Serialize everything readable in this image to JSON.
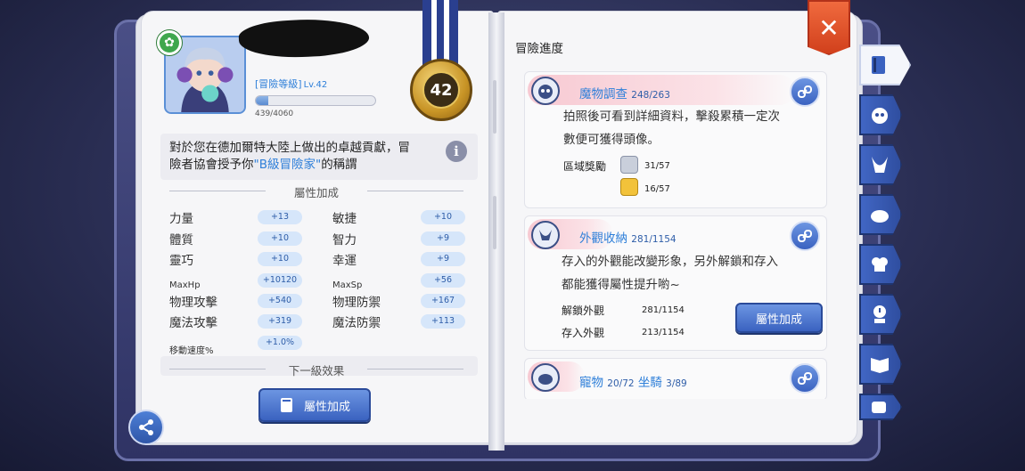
{
  "player": {
    "adventure_level_label": "[冒險等級]",
    "level": "Lv.42",
    "exp_text": "439/4060",
    "exp_fraction": 0.108,
    "medal_level": "42"
  },
  "description": {
    "line1": "對於您在德加爾特大陸上做出的卓越貢獻，冒",
    "line2_prefix": "險者協會授予你",
    "title_name": "\"B級冒險家\"",
    "line2_suffix": "的稱謂"
  },
  "stats_section": {
    "heading": "屬性加成",
    "left": [
      {
        "label": "力量",
        "value": "+13"
      },
      {
        "label": "體質",
        "value": "+10"
      },
      {
        "label": "靈巧",
        "value": "+10"
      },
      {
        "label": "MaxHp",
        "value": "+10120"
      },
      {
        "label": "物理攻擊",
        "value": "+540"
      },
      {
        "label": "魔法攻擊",
        "value": "+319"
      },
      {
        "label": "移動速度%",
        "value": "+1.0%"
      }
    ],
    "right": [
      {
        "label": "敏捷",
        "value": "+10"
      },
      {
        "label": "智力",
        "value": "+9"
      },
      {
        "label": "幸運",
        "value": "+9"
      },
      {
        "label": "MaxSp",
        "value": "+56"
      },
      {
        "label": "物理防禦",
        "value": "+167"
      },
      {
        "label": "魔法防禦",
        "value": "+113"
      }
    ],
    "next_level_heading": "下一級效果",
    "button_label": "屬性加成"
  },
  "progress": {
    "title": "冒險進度",
    "monster": {
      "title": "魔物調查",
      "count": "248/263",
      "text1": "拍照後可看到詳細資料，擊殺累積一定次",
      "text2": "數便可獲得頭像。",
      "reward_label": "區域獎勵",
      "reward1": "31/57",
      "reward2": "16/57"
    },
    "appearance": {
      "title": "外觀收納",
      "count": "281/1154",
      "text1": "存入的外觀能改變形象，另外解鎖和存入",
      "text2": "都能獲得屬性提升喲~",
      "unlocked_label": "解鎖外觀",
      "unlocked_value": "281/1154",
      "stored_label": "存入外觀",
      "stored_value": "213/1154",
      "button_label": "屬性加成"
    },
    "pet": {
      "title": "寵物",
      "pet_count": "20/72",
      "mount_title": "坐騎",
      "mount_count": "3/89"
    }
  },
  "icons": {
    "close": "close-icon",
    "share": "share-icon",
    "info": "info-icon",
    "link": "link-icon"
  },
  "colors": {
    "accent_blue": "#2e7fd9",
    "close_red": "#d1401c",
    "medal_gold": "#c89426"
  }
}
